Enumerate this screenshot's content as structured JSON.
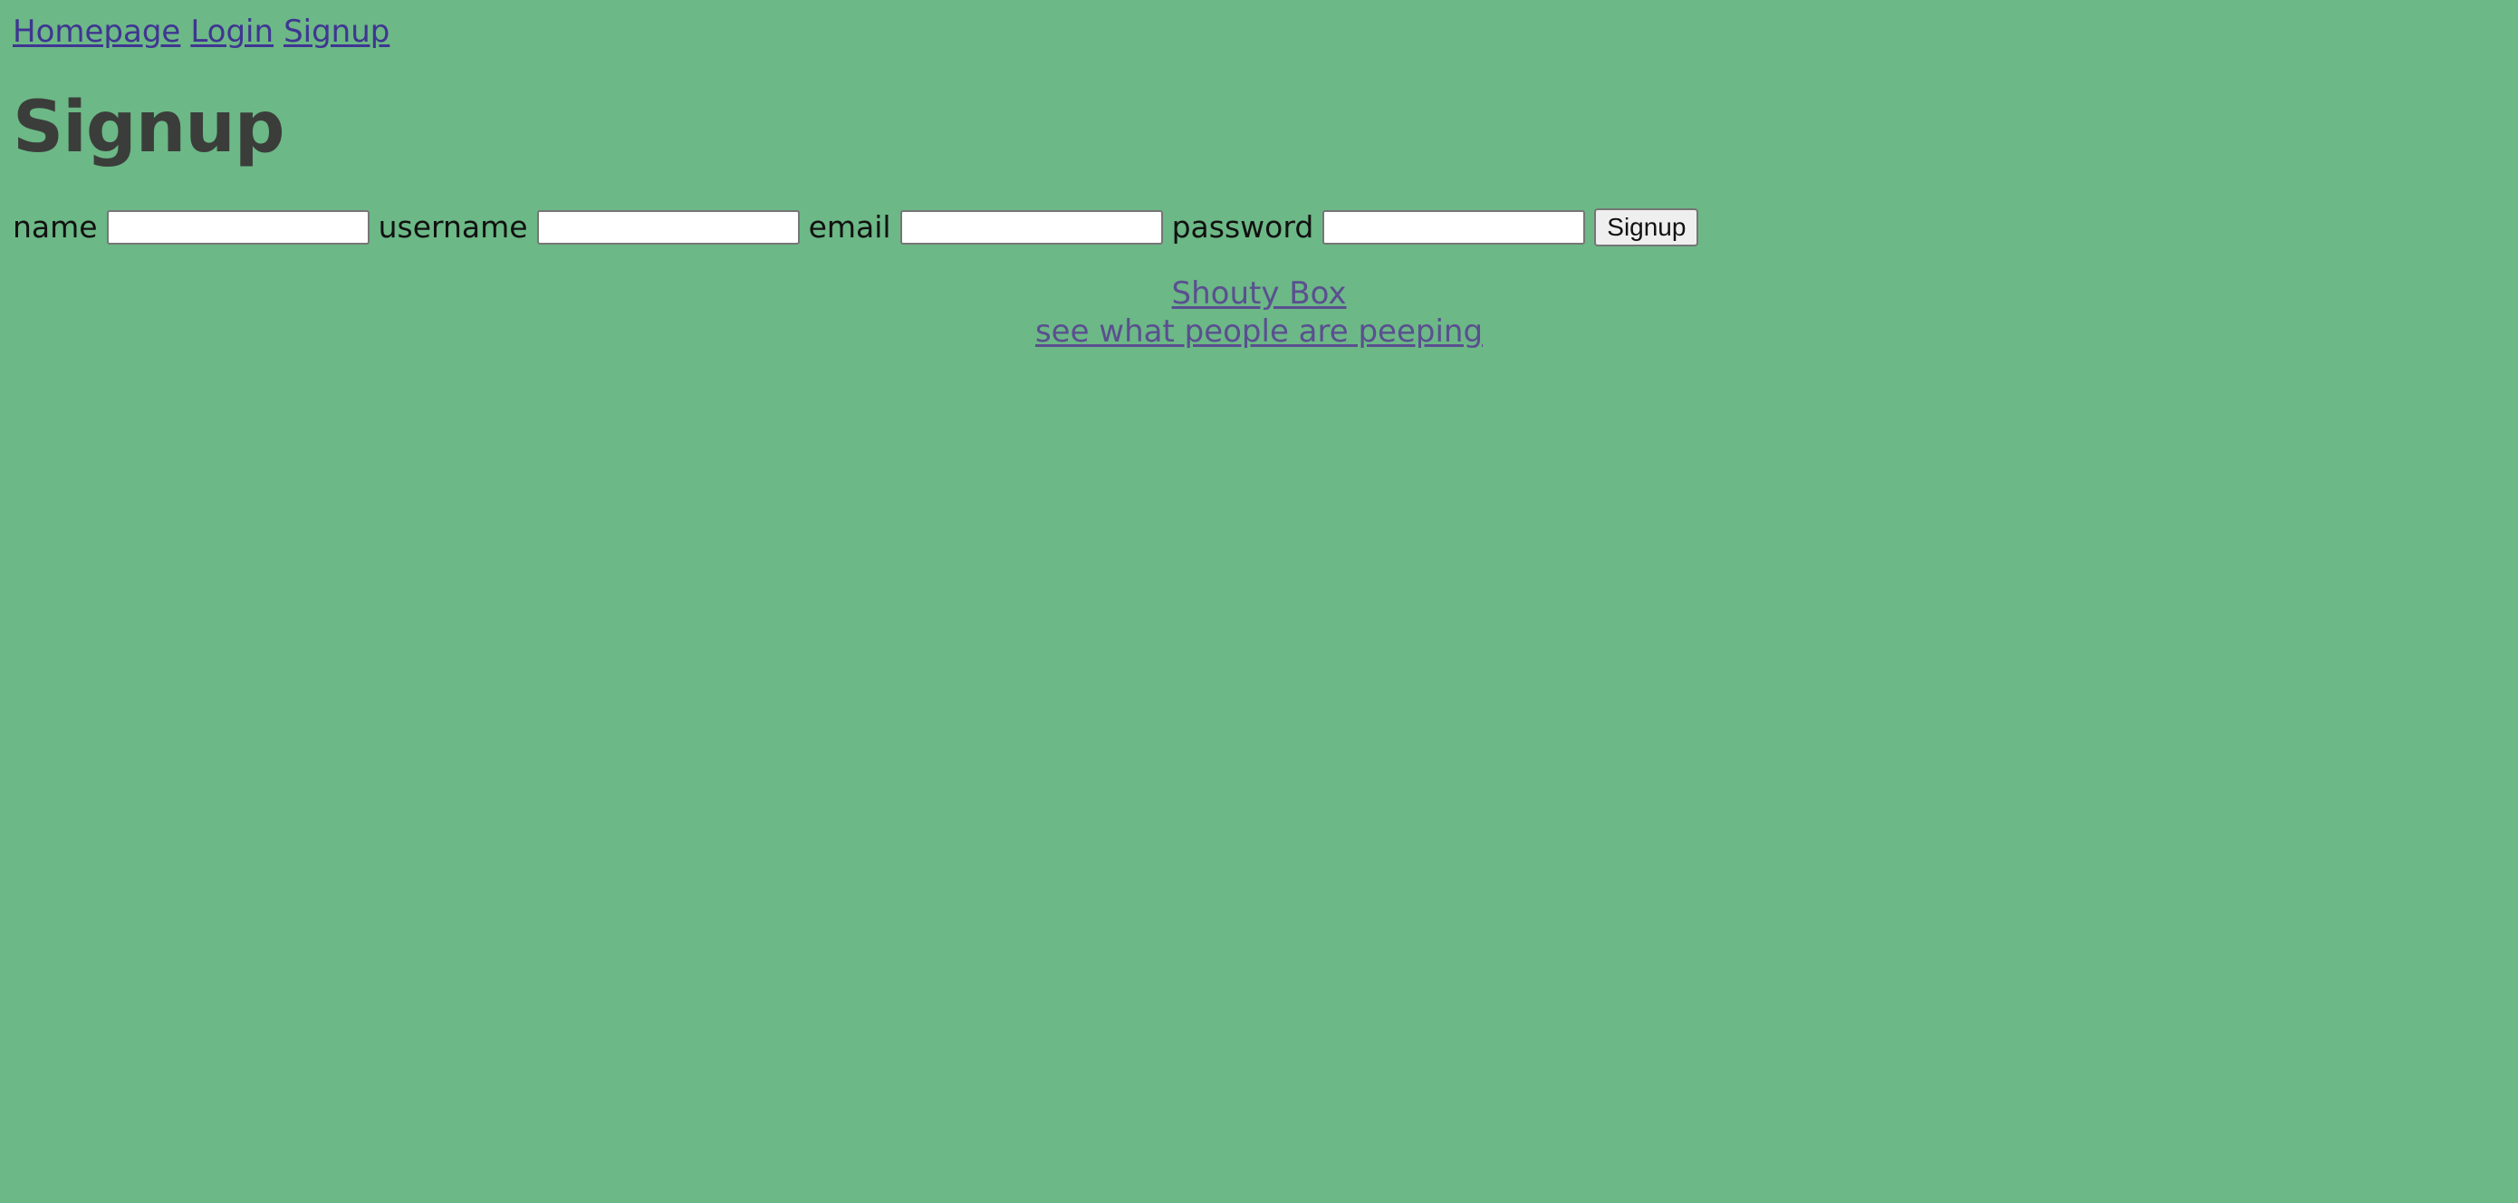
{
  "page": {
    "background": "#6cb886"
  },
  "nav": {
    "items": [
      {
        "label": "Homepage"
      },
      {
        "label": "Login"
      },
      {
        "label": "Signup"
      }
    ]
  },
  "heading": {
    "title": "Signup"
  },
  "form": {
    "fields": [
      {
        "label": "name",
        "value": ""
      },
      {
        "label": "username",
        "value": ""
      },
      {
        "label": "email",
        "value": ""
      },
      {
        "label": "password",
        "value": ""
      }
    ],
    "submit_label": "Signup"
  },
  "footer": {
    "brand": "Shouty Box",
    "tagline": "see what people are peeping"
  },
  "colors": {
    "link": "#3f3592",
    "heading": "#3b3d3b",
    "footer_link": "#5a4f90"
  }
}
